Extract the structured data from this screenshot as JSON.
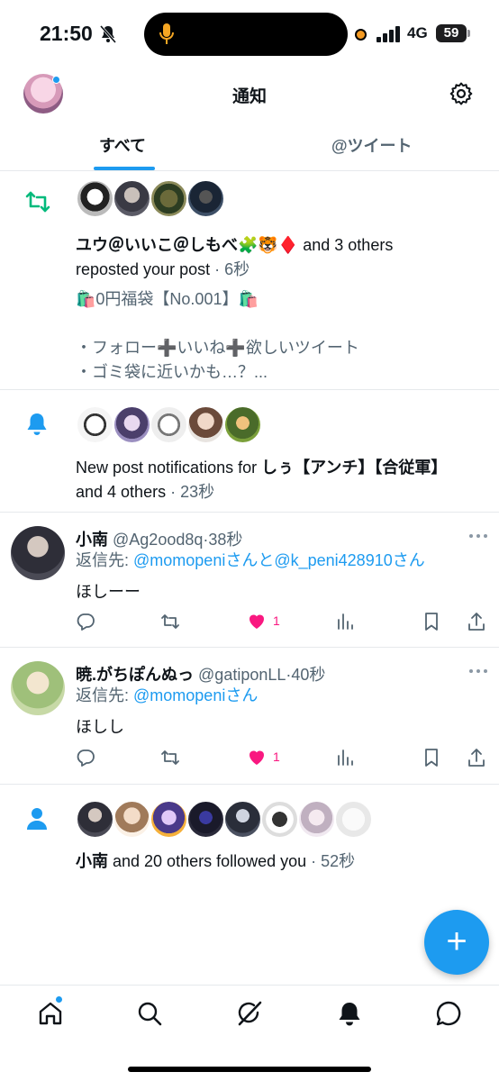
{
  "status_bar": {
    "time": "21:50",
    "network": "4G",
    "battery": "59"
  },
  "header": {
    "title": "通知"
  },
  "tabs": [
    {
      "label": "すべて",
      "active": true
    },
    {
      "label": "@ツイート",
      "active": false
    }
  ],
  "notifications": {
    "repost": {
      "names": "ユウ＠いいこ＠しもべ🧩🐯♦️",
      "others": " and 3 others",
      "action": "reposted your post",
      "time": "6秒",
      "post_line1": "🛍️0円福袋【No.001】🛍️",
      "post_line2": "・フォロー➕いいね➕欲しいツイート",
      "post_line3": "・ゴミ袋に近いかも…？..."
    },
    "new_post": {
      "prefix": "New post notifications for ",
      "name": "しぅ【アンチ】【合従軍】",
      "others": "and 4 others",
      "time": "23秒"
    },
    "follow": {
      "name": "小南",
      "text": " and 20 others followed you",
      "time": "52秒"
    }
  },
  "tweets": [
    {
      "display_name": "小南",
      "handle": "@Ag2ood8q",
      "time": "38秒",
      "reply_label": "返信先: ",
      "reply_to1": "@momopeni",
      "reply_mid": "さんと",
      "reply_to2": "@k_peni428910",
      "reply_end": "さん",
      "body": "ほしーー",
      "likes": "1"
    },
    {
      "display_name": "暁.がちぽんぬっ",
      "handle": "@gatiponLL",
      "time": "40秒",
      "reply_label": "返信先: ",
      "reply_to1": "@momopeni",
      "reply_end": "さん",
      "body": "ほしし",
      "likes": "1"
    }
  ],
  "colors": {
    "accent": "#1d9bf0",
    "like": "#f91880",
    "repost_green": "#00ba7c",
    "muted": "#536471"
  },
  "icons": [
    "bell-off-icon",
    "mic-icon",
    "gear-icon",
    "repost-icon",
    "bell-icon",
    "person-icon",
    "reply-icon",
    "retweet-icon",
    "heart-icon",
    "views-icon",
    "bookmark-icon",
    "share-icon",
    "more-icon",
    "home-icon",
    "search-icon",
    "grok-icon",
    "notifications-icon",
    "messages-icon",
    "plus-icon"
  ]
}
